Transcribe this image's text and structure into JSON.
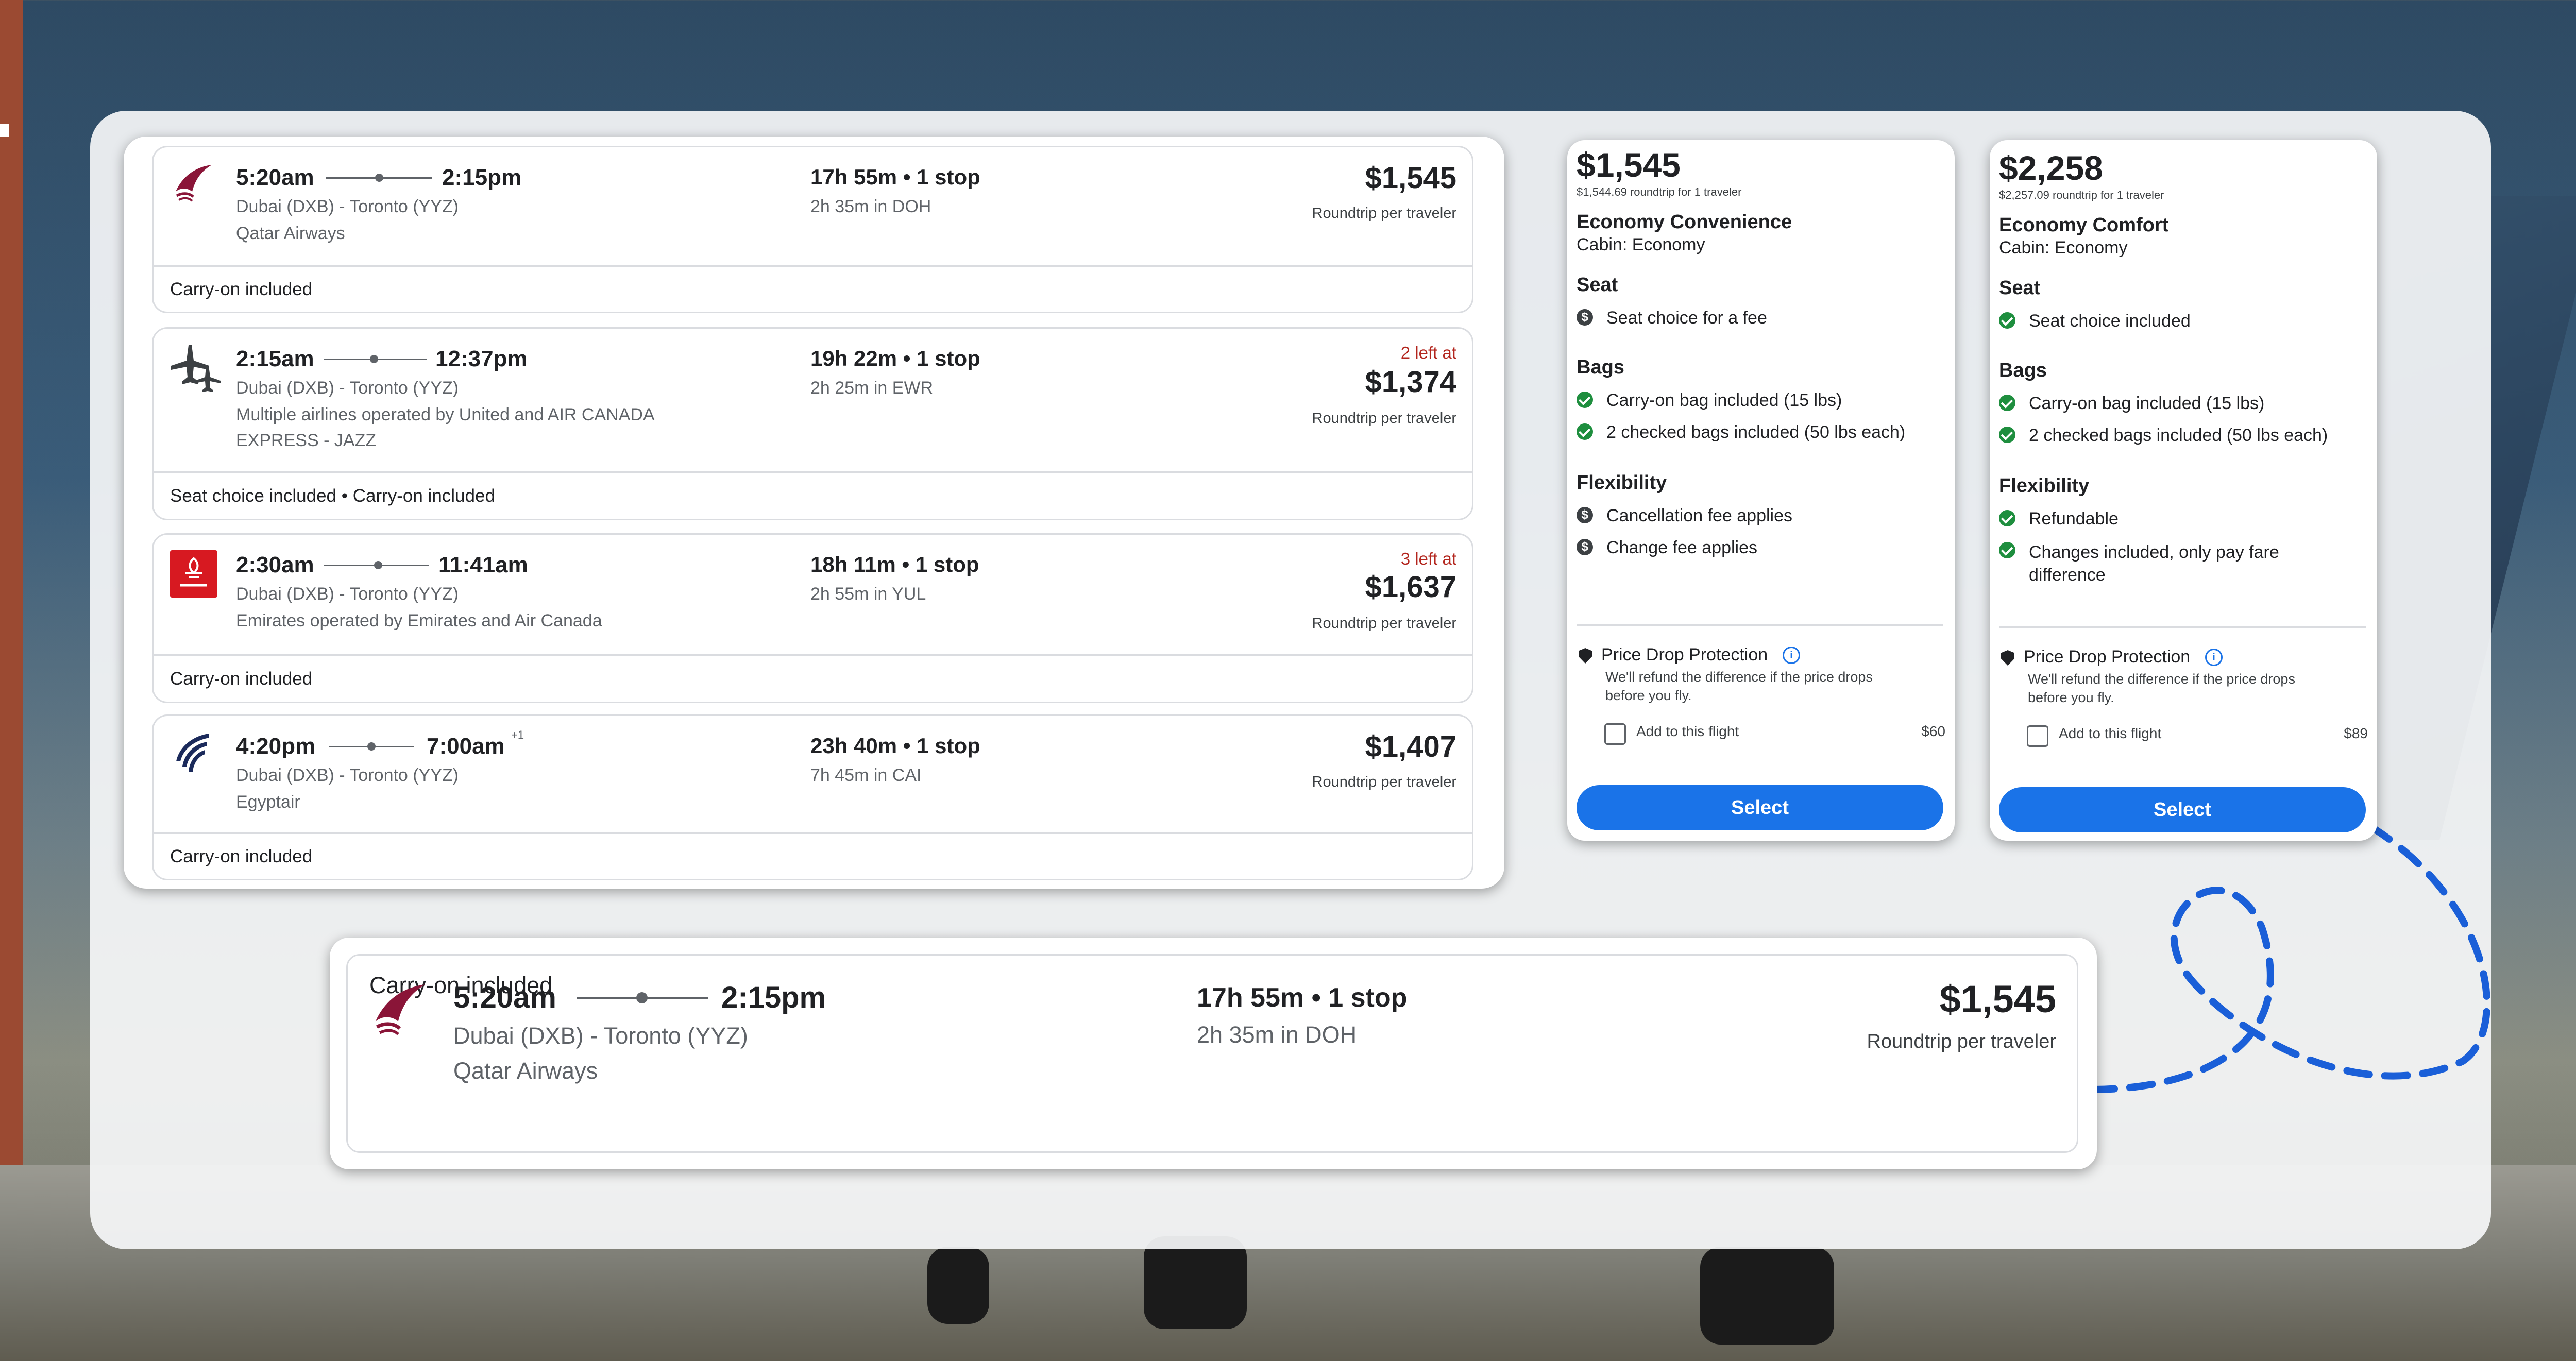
{
  "flights": [
    {
      "depart": "5:20am",
      "arrive": "2:15pm",
      "arrive_day_offset": "",
      "route": "Dubai (DXB) - Toronto (YYZ)",
      "airline": "Qatar Airways",
      "airline_extra": "",
      "duration": "17h 55m • 1 stop",
      "layover": "2h 35m in DOH",
      "seats_left": "",
      "price": "$1,545",
      "price_note": "Roundtrip per traveler",
      "perks": "Carry-on included",
      "logo_icon": "qatar-airways-logo-icon"
    },
    {
      "depart": "2:15am",
      "arrive": "12:37pm",
      "arrive_day_offset": "",
      "route": "Dubai (DXB) - Toronto (YYZ)",
      "airline": "Multiple airlines operated by United and AIR CANADA",
      "airline_extra": "EXPRESS - JAZZ",
      "duration": "19h 22m • 1 stop",
      "layover": "2h 25m in EWR",
      "seats_left": "2 left at",
      "price": "$1,374",
      "price_note": "Roundtrip per traveler",
      "perks": "Seat choice included • Carry-on included",
      "logo_icon": "multiple-airlines-plane-icon"
    },
    {
      "depart": "2:30am",
      "arrive": "11:41am",
      "arrive_day_offset": "",
      "route": "Dubai (DXB) - Toronto (YYZ)",
      "airline": "Emirates operated by Emirates and Air Canada",
      "airline_extra": "",
      "duration": "18h 11m • 1 stop",
      "layover": "2h 55m in YUL",
      "seats_left": "3 left at",
      "price": "$1,637",
      "price_note": "Roundtrip per traveler",
      "perks": "Carry-on included",
      "logo_icon": "emirates-logo-icon"
    },
    {
      "depart": "4:20pm",
      "arrive": "7:00am",
      "arrive_day_offset": "+1",
      "route": "Dubai (DXB) - Toronto (YYZ)",
      "airline": "Egyptair",
      "airline_extra": "",
      "duration": "23h 40m • 1 stop",
      "layover": "7h 45m in CAI",
      "seats_left": "",
      "price": "$1,407",
      "price_note": "Roundtrip per traveler",
      "perks": "Carry-on included",
      "logo_icon": "egyptair-logo-icon"
    }
  ],
  "fares": [
    {
      "price": "$1,545",
      "exact": "$1,544.69 roundtrip for 1 traveler",
      "name": "Economy Convenience",
      "cabin": "Cabin: Economy",
      "seat_heading": "Seat",
      "seat": [
        "Seat choice for a fee"
      ],
      "seat_status": [
        "fee"
      ],
      "bags_heading": "Bags",
      "bags": [
        "Carry-on bag included (15 lbs)",
        "2 checked bags included (50 lbs each)"
      ],
      "flex_heading": "Flexibility",
      "flex": [
        "Cancellation fee applies",
        "Change fee applies"
      ],
      "flex_status": [
        "fee",
        "fee"
      ],
      "pdp_title": "Price Drop Protection",
      "pdp_desc": "We'll refund the difference if the price drops before you fly.",
      "add_label": "Add to this flight",
      "add_price": "$60",
      "select_label": "Select"
    },
    {
      "price": "$2,258",
      "exact": "$2,257.09 roundtrip for 1 traveler",
      "name": "Economy Comfort",
      "cabin": "Cabin: Economy",
      "seat_heading": "Seat",
      "seat": [
        "Seat choice included"
      ],
      "seat_status": [
        "ok"
      ],
      "bags_heading": "Bags",
      "bags": [
        "Carry-on bag included (15 lbs)",
        "2 checked bags included (50 lbs each)"
      ],
      "flex_heading": "Flexibility",
      "flex": [
        "Refundable",
        "Changes included, only pay fare difference"
      ],
      "flex_status": [
        "ok",
        "ok"
      ],
      "pdp_title": "Price Drop Protection",
      "pdp_desc": "We'll refund the difference if the price drops before you fly.",
      "add_label": "Add to this flight",
      "add_price": "$89",
      "select_label": "Select"
    }
  ],
  "highlight": {
    "depart": "5:20am",
    "arrive": "2:15pm",
    "route": "Dubai (DXB) - Toronto (YYZ)",
    "airline": "Qatar Airways",
    "duration": "17h 55m • 1 stop",
    "layover": "2h 35m in DOH",
    "price": "$1,545",
    "price_note": "Roundtrip per traveler",
    "perks": "Carry-on included"
  },
  "colors": {
    "primary_button": "#1a73e8",
    "included_green": "#1e8e3e",
    "seats_left_red": "#b3261e",
    "qatar_maroon": "#8a1538",
    "emirates_red": "#d71921",
    "egyptair_navy": "#1b2a5b"
  }
}
